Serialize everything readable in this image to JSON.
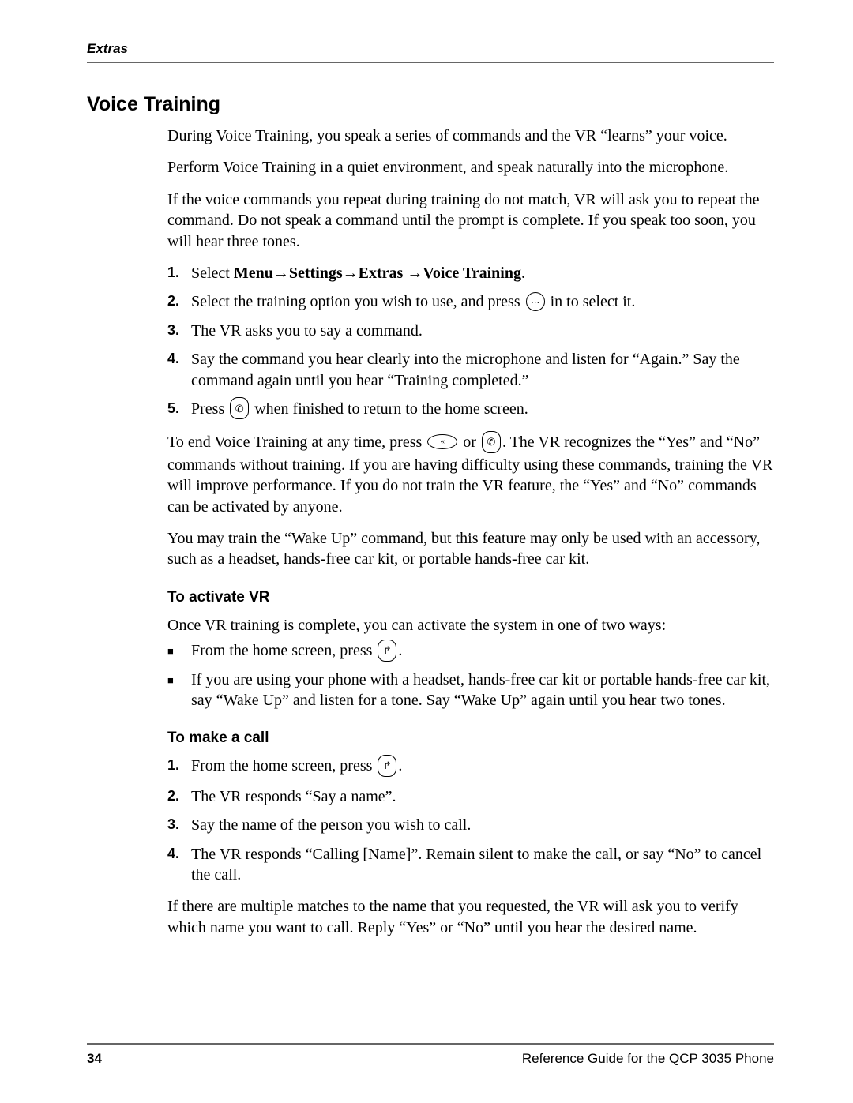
{
  "header": {
    "chapter": "Extras"
  },
  "section": {
    "title": "Voice Training"
  },
  "intro": {
    "p1": "During Voice Training, you speak a series of commands and the VR “learns” your voice.",
    "p2": "Perform Voice Training in a quiet environment, and speak naturally into the microphone.",
    "p3": "If the voice commands you repeat during training do not match, VR will ask you to repeat the command. Do not speak a command until the prompt is complete. If you speak too soon, you will hear three tones."
  },
  "steps": [
    {
      "num": "1.",
      "prefix": "Select ",
      "menu_path": "Menu→Settings→Extras →Voice Training",
      "suffix": "."
    },
    {
      "num": "2.",
      "text_a": "Select the training option you wish to use, and press ",
      "text_b": " in to select it."
    },
    {
      "num": "3.",
      "text": "The VR asks you to say a command."
    },
    {
      "num": "4.",
      "text": "Say the command you hear clearly into the microphone and listen for “Again.” Say the command again until you hear “Training completed.”"
    },
    {
      "num": "5.",
      "text_a": "Press ",
      "text_b": " when finished to return to the home screen."
    }
  ],
  "post": {
    "p1a": "To end Voice Training at any time, press ",
    "p1mid": " or ",
    "p1b": ". The VR recognizes the “Yes” and “No” commands without training. If you are having difficulty using these commands, training the VR will improve performance. If you do not train the VR feature, the “Yes” and “No” commands can be activated by anyone.",
    "p2": "You may train the “Wake Up” command, but this feature may only be used with an accessory, such as a headset, hands-free car kit, or portable hands-free car kit."
  },
  "activate": {
    "title": "To activate VR",
    "intro": "Once VR training is complete, you can activate the system in one of two ways:",
    "bullets": [
      {
        "text_a": "From the home screen, press ",
        "text_b": "."
      },
      {
        "text": "If you are using your phone with a headset, hands-free car kit or portable hands-free car kit, say “Wake Up” and listen for a tone. Say “Wake Up” again until you hear two tones."
      }
    ]
  },
  "makecall": {
    "title": "To make a call",
    "steps": [
      {
        "num": "1.",
        "text_a": "From the home screen, press ",
        "text_b": "."
      },
      {
        "num": "2.",
        "text": "The VR responds “Say a name”."
      },
      {
        "num": "3.",
        "text": "Say the name of the person you wish to call."
      },
      {
        "num": "4.",
        "text": "The VR responds “Calling [Name]”. Remain silent to make the call, or say “No” to cancel the call."
      }
    ],
    "post": "If there are multiple matches to the name that you requested, the VR will ask you to verify which name you want to call. Reply “Yes” or “No” until you hear the desired name."
  },
  "footer": {
    "page": "34",
    "title": "Reference Guide for the QCP 3035 Phone"
  },
  "icons": {
    "ok_glyph": "…",
    "end_glyph": "✆",
    "clr_glyph": "«",
    "talk_glyph": "↱"
  }
}
